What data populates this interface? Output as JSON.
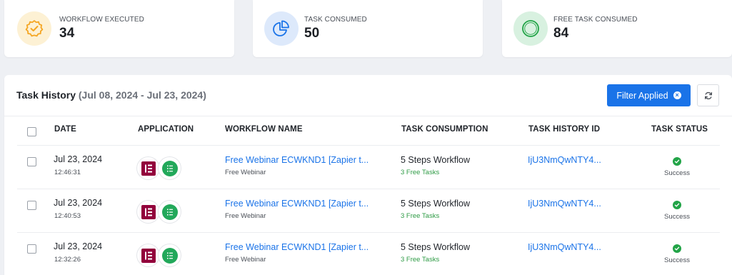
{
  "stats": [
    {
      "label": "WORKFLOW EXECUTED",
      "value": "34",
      "icon": "badge-check-icon",
      "color": "#f5a623",
      "bg": "#fdf1d4"
    },
    {
      "label": "TASK CONSUMED",
      "value": "50",
      "icon": "pie-chart-icon",
      "color": "#1a73e8",
      "bg": "#dde9fb"
    },
    {
      "label": "FREE TASK CONSUMED",
      "value": "84",
      "icon": "free-badge-icon",
      "color": "#22a447",
      "bg": "#d8f1e0"
    }
  ],
  "panel": {
    "title": "Task History",
    "range": "(Jul 08, 2024 - Jul 23, 2024)",
    "filter_label": "Filter Applied"
  },
  "table": {
    "headers": {
      "date": "DATE",
      "application": "APPLICATION",
      "workflow_name": "WORKFLOW NAME",
      "task_consumption": "TASK CONSUMPTION",
      "task_history_id": "TASK HISTORY ID",
      "task_status": "TASK STATUS"
    },
    "rows": [
      {
        "date": "Jul 23, 2024",
        "time": "12:46:31",
        "workflow": "Free Webinar ECWKND1 [Zapier t...",
        "workflow_sub": "Free Webinar",
        "consumption": "5 Steps Workflow",
        "consumption_sub": "3 Free Tasks",
        "history_id": "IjU3NmQwNTY4...",
        "status": "Success"
      },
      {
        "date": "Jul 23, 2024",
        "time": "12:40:53",
        "workflow": "Free Webinar ECWKND1 [Zapier t...",
        "workflow_sub": "Free Webinar",
        "consumption": "5 Steps Workflow",
        "consumption_sub": "3 Free Tasks",
        "history_id": "IjU3NmQwNTY4...",
        "status": "Success"
      },
      {
        "date": "Jul 23, 2024",
        "time": "12:32:26",
        "workflow": "Free Webinar ECWKND1 [Zapier t...",
        "workflow_sub": "Free Webinar",
        "consumption": "5 Steps Workflow",
        "consumption_sub": "3 Free Tasks",
        "history_id": "IjU3NmQwNTY4...",
        "status": "Success"
      }
    ]
  },
  "app_icons": [
    "elementor-icon",
    "list-form-icon"
  ],
  "colors": {
    "accent": "#1a73e8",
    "success": "#22a447",
    "elementor": "#92003b"
  }
}
